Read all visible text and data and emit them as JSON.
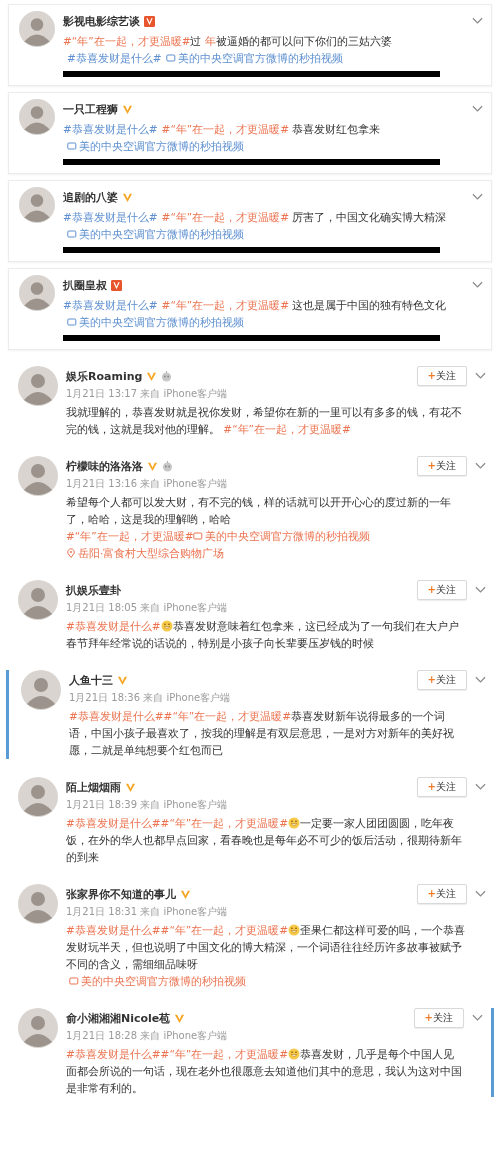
{
  "posts": [
    {
      "kind": "card",
      "name": "影视电影综艺谈",
      "verified": true,
      "badge_boxed": true,
      "member": false,
      "redacted": true,
      "body": [
        {
          "kind": "topic_red",
          "text": "#“年”在一起，才更温暖#"
        },
        {
          "kind": "text",
          "text": "过"
        },
        {
          "kind": "topic_red",
          "text": "年"
        },
        {
          "kind": "text",
          "text": "被逼婚的都可以问下你们的三姑六婆"
        },
        {
          "kind": "topic_blue",
          "text": "#恭喜发财是什么#"
        },
        {
          "kind": "video_blue",
          "text": "美的中央空调官方微博的秒拍视频"
        }
      ]
    },
    {
      "kind": "card",
      "name": "一只工程狮",
      "verified": true,
      "badge_boxed": false,
      "member": false,
      "redacted": true,
      "body": [
        {
          "kind": "topic_blue",
          "text": "#恭喜发财是什么#"
        },
        {
          "kind": "topic_red",
          "text": "#“年”在一起，才更温暖#"
        },
        {
          "kind": "text",
          "text": " 恭喜发财红包拿来"
        },
        {
          "kind": "video_blue",
          "text": "美的中央空调官方微博的秒拍视频"
        }
      ]
    },
    {
      "kind": "card",
      "name": "追剧的八婆",
      "verified": true,
      "badge_boxed": false,
      "member": false,
      "redacted": true,
      "body": [
        {
          "kind": "topic_blue",
          "text": "#恭喜发财是什么#"
        },
        {
          "kind": "topic_red",
          "text": "#“年”在一起，才更温暖#"
        },
        {
          "kind": "text",
          "text": " 厉害了，中国文化确实博大精深"
        },
        {
          "kind": "video_blue",
          "text": "美的中央空调官方微博的秒拍视频"
        }
      ]
    },
    {
      "kind": "card",
      "name": "扒圈皇叔",
      "verified": true,
      "badge_boxed": true,
      "member": false,
      "redacted": true,
      "body": [
        {
          "kind": "topic_blue",
          "text": "#恭喜发财是什么#"
        },
        {
          "kind": "topic_red",
          "text": "#“年”在一起，才更温暖#"
        },
        {
          "kind": "text",
          "text": " 这也是属于中国的独有特色文化"
        },
        {
          "kind": "video_blue",
          "text": "美的中央空调官方微博的秒拍视频"
        }
      ]
    },
    {
      "kind": "feed",
      "name": "娱乐Roaming",
      "verified": true,
      "badge_boxed": false,
      "member": true,
      "follow": "+关注",
      "meta": "1月21日 13:17 来自 iPhone客户端",
      "body": [
        {
          "kind": "text",
          "text": "我就理解的，恭喜发财就是祝你发财，希望你在新的一里可以有多多的钱，有花不完的钱，这就是我对他的理解。 "
        },
        {
          "kind": "topic_red",
          "text": "#“年”在一起，才更温暖#"
        }
      ]
    },
    {
      "kind": "feed",
      "name": "柠檬味的洛洛洛",
      "verified": true,
      "badge_boxed": false,
      "member": true,
      "follow": "+关注",
      "meta": "1月21日 13:16 来自 iPhone客户端",
      "body": [
        {
          "kind": "text",
          "text": "希望每个人都可以发大财，有不完的钱，样的话就可以开开心心的度过新的一年了，哈哈，这是我的理解哟，哈哈"
        },
        {
          "kind": "break"
        },
        {
          "kind": "topic_red",
          "text": "#“年”在一起，才更温暖#"
        },
        {
          "kind": "video_red",
          "text": "美的中央空调官方微博的秒拍视频"
        },
        {
          "kind": "place",
          "text": "岳阳·富食村大型综合购物广场"
        }
      ]
    },
    {
      "kind": "feed",
      "name": "扒娱乐壹卦",
      "verified": false,
      "member": false,
      "follow": "+关注",
      "meta": "1月21日 18:05 来自 iPhone客户端",
      "body": [
        {
          "kind": "topic_red",
          "text": "#恭喜发财是什么#"
        },
        {
          "kind": "emoji"
        },
        {
          "kind": "text",
          "text": "恭喜发财意味着红包拿来，这已经成为了一句我们在大户户春节拜年经常说的话说的，特别是小孩子向长辈要压岁钱的时候"
        }
      ]
    },
    {
      "kind": "feed",
      "name": "人鱼十三",
      "verified": true,
      "badge_boxed": false,
      "member": false,
      "accent_left": true,
      "follow": "+关注",
      "meta": "1月21日 18:36 来自 iPhone客户端",
      "body": [
        {
          "kind": "topic_red",
          "text": "#恭喜发财是什么#"
        },
        {
          "kind": "topic_red",
          "text": "#“年”在一起，才更温暖#"
        },
        {
          "kind": "text",
          "text": "恭喜发财新年说得最多的一个词语，中国小孩子最喜欢了，按我的理解是有双层意思，一是对方对新年的美好祝愿，二就是单纯想要个红包而已"
        }
      ]
    },
    {
      "kind": "feed",
      "name": "陌上烟烟雨",
      "verified": true,
      "badge_boxed": false,
      "member": false,
      "follow": "+关注",
      "meta": "1月21日 18:39 来自 iPhone客户端",
      "body": [
        {
          "kind": "topic_red",
          "text": "#恭喜发财是什么#"
        },
        {
          "kind": "topic_red",
          "text": "#“年”在一起，才更温暖#"
        },
        {
          "kind": "emoji"
        },
        {
          "kind": "text",
          "text": "一定要一家人团团圆圆，吃年夜饭，在外的华人也都早点回家，看春晚也是每年必不可少的饭后活动，很期待新年的到来"
        }
      ]
    },
    {
      "kind": "feed",
      "name": "张家界你不知道的事儿",
      "verified": true,
      "badge_boxed": false,
      "member": false,
      "follow": "+关注",
      "meta": "1月21日 18:31 来自 iPhone客户端",
      "body": [
        {
          "kind": "topic_red",
          "text": "#恭喜发财是什么#"
        },
        {
          "kind": "topic_red",
          "text": "#“年”在一起，才更温暖#"
        },
        {
          "kind": "emoji"
        },
        {
          "kind": "text",
          "text": "歪果仁都这样可爱的吗，一个恭喜发财玩半天，但也说明了中国文化的博大精深，一个词语往往经历许多故事被赋予不同的含义，需细细品味呀"
        },
        {
          "kind": "break"
        },
        {
          "kind": "video_red",
          "text": "美的中央空调官方微博的秒拍视频"
        }
      ]
    },
    {
      "kind": "feed",
      "name": "俞小湘湘湘Nicole苞",
      "verified": true,
      "badge_boxed": false,
      "member": false,
      "accent_right": true,
      "follow": "+关注",
      "meta": "1月21日 18:28 来自 iPhone客户端",
      "body": [
        {
          "kind": "topic_red",
          "text": "#恭喜发财是什么#"
        },
        {
          "kind": "topic_red",
          "text": "#“年”在一起，才更温暖#"
        },
        {
          "kind": "emoji"
        },
        {
          "kind": "text",
          "text": "恭喜发财，几乎是每个中国人见面都会所说的一句话，现在老外也很愿意去知道他们其中的意思，我认为这对中国是非常有利的。"
        }
      ]
    }
  ]
}
